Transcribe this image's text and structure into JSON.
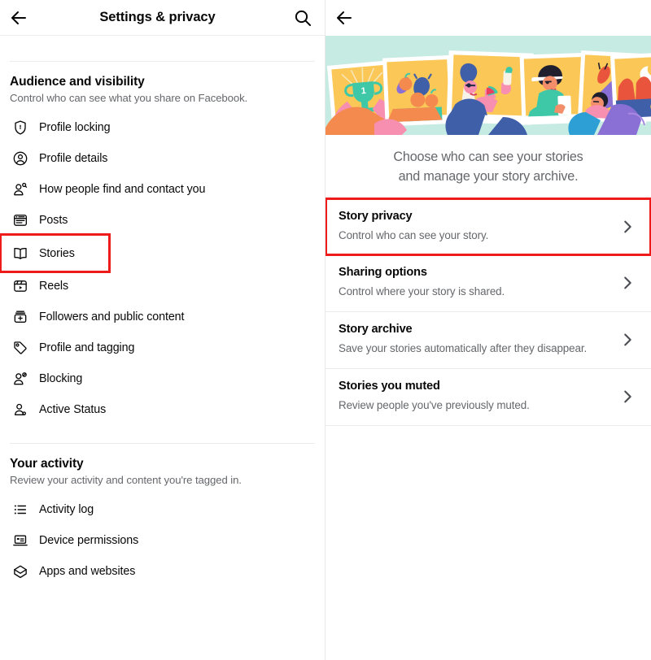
{
  "left": {
    "header": {
      "back_icon": "back-arrow-icon",
      "title": "Settings & privacy",
      "search_icon": "search-icon"
    },
    "sections": [
      {
        "title": "Audience and visibility",
        "subtitle": "Control who can see what you share on Facebook.",
        "items": [
          {
            "label": "Profile locking",
            "icon": "shield-lock-icon",
            "highlighted": false
          },
          {
            "label": "Profile details",
            "icon": "profile-circle-icon",
            "highlighted": false
          },
          {
            "label": "How people find and contact you",
            "icon": "person-search-icon",
            "highlighted": false
          },
          {
            "label": "Posts",
            "icon": "post-card-icon",
            "highlighted": false
          },
          {
            "label": "Stories",
            "icon": "book-open-icon",
            "highlighted": true
          },
          {
            "label": "Reels",
            "icon": "reels-play-icon",
            "highlighted": false
          },
          {
            "label": "Followers and public content",
            "icon": "followers-plus-icon",
            "highlighted": false
          },
          {
            "label": "Profile and tagging",
            "icon": "tag-icon",
            "highlighted": false
          },
          {
            "label": "Blocking",
            "icon": "person-block-icon",
            "highlighted": false
          },
          {
            "label": "Active Status",
            "icon": "person-status-icon",
            "highlighted": false
          }
        ]
      },
      {
        "title": "Your activity",
        "subtitle": "Review your activity and content you're tagged in.",
        "items": [
          {
            "label": "Activity log",
            "icon": "list-icon",
            "highlighted": false
          },
          {
            "label": "Device permissions",
            "icon": "laptop-icon",
            "highlighted": false
          },
          {
            "label": "Apps and websites",
            "icon": "apps-websites-icon",
            "highlighted": false
          }
        ]
      }
    ]
  },
  "right": {
    "header": {
      "back_icon": "back-arrow-icon"
    },
    "hero": {
      "illustration_name": "story-photos-illustration",
      "background_color": "#c6ebe2"
    },
    "caption_line1": "Choose who can see your stories",
    "caption_line2": "and manage your story archive.",
    "options": [
      {
        "title": "Story privacy",
        "subtitle": "Control who can see your story.",
        "chevron": "chevron-right-icon",
        "highlighted": true
      },
      {
        "title": "Sharing options",
        "subtitle": "Control where your story is shared.",
        "chevron": "chevron-right-icon",
        "highlighted": false
      },
      {
        "title": "Story archive",
        "subtitle": "Save your stories automatically after they disappear.",
        "chevron": "chevron-right-icon",
        "highlighted": false
      },
      {
        "title": "Stories you muted",
        "subtitle": "Review people you've previously muted.",
        "chevron": "chevron-right-icon",
        "highlighted": false
      }
    ]
  },
  "colors": {
    "highlight_red": "#ee1b1b",
    "text_primary": "#080809",
    "text_secondary": "#65676b",
    "divider": "#ececec",
    "hero_background": "#c6ebe2",
    "photo_yellow": "#fbc757",
    "photo_frame": "#ffffff"
  }
}
